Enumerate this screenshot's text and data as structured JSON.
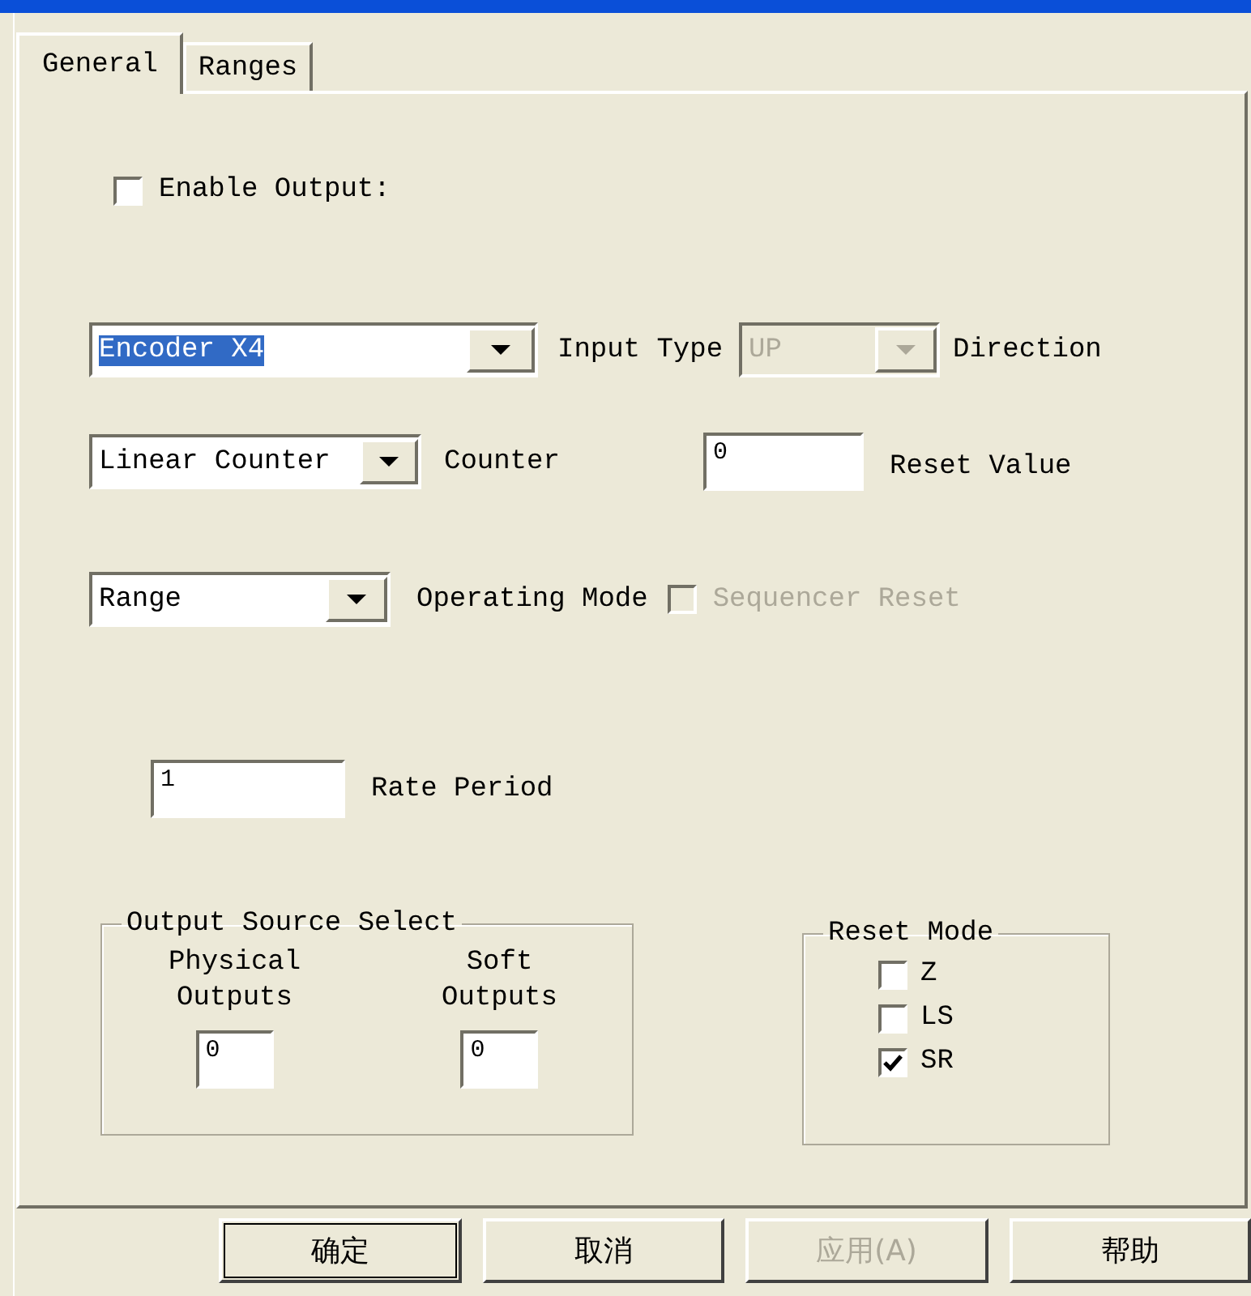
{
  "tabs": [
    {
      "label": "General",
      "selected": true
    },
    {
      "label": "Ranges",
      "selected": false
    }
  ],
  "enable_output": {
    "label": "Enable Output:",
    "checked": false
  },
  "input_type": {
    "value": "Encoder X4",
    "text_selected": true,
    "label": "Input Type"
  },
  "direction": {
    "value": "UP",
    "disabled": true,
    "label": "Direction"
  },
  "counter": {
    "value": "Linear Counter",
    "label": "Counter"
  },
  "reset_value": {
    "value": "0",
    "label": "Reset Value"
  },
  "operating_mode": {
    "value": "Range",
    "label": "Operating Mode"
  },
  "sequencer_reset": {
    "label": "Sequencer Reset",
    "checked": false,
    "disabled": true
  },
  "rate_period": {
    "value": "1",
    "label": "Rate Period"
  },
  "output_source_select": {
    "title": "Output Source Select",
    "columns": [
      {
        "label": "Physical Outputs",
        "value": "0"
      },
      {
        "label": "Soft Outputs",
        "value": "0"
      }
    ]
  },
  "reset_mode": {
    "title": "Reset Mode",
    "options": [
      {
        "label": "Z",
        "checked": false
      },
      {
        "label": "LS",
        "checked": false
      },
      {
        "label": "SR",
        "checked": true
      }
    ]
  },
  "buttons": [
    {
      "label": "确定",
      "default": true,
      "disabled": false
    },
    {
      "label": "取消",
      "default": false,
      "disabled": false
    },
    {
      "label": "应用(A)",
      "default": false,
      "disabled": true
    },
    {
      "label": "帮助",
      "default": false,
      "disabled": false
    }
  ]
}
